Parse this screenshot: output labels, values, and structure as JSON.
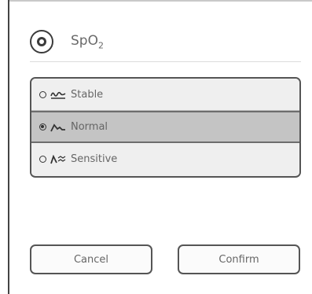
{
  "header": {
    "icon": "spo2-parameter-icon",
    "title_main": "SpO",
    "title_sub": "2"
  },
  "options": [
    {
      "label": "Stable",
      "icon": "stable-waveform-icon",
      "selected": false
    },
    {
      "label": "Normal",
      "icon": "normal-waveform-icon",
      "selected": true
    },
    {
      "label": "Sensitive",
      "icon": "sensitive-waveform-icon",
      "selected": false
    }
  ],
  "buttons": {
    "cancel": "Cancel",
    "confirm": "Confirm"
  },
  "colors": {
    "selected_row": "#c4c4c4",
    "row": "#efefef",
    "border": "#555555"
  }
}
